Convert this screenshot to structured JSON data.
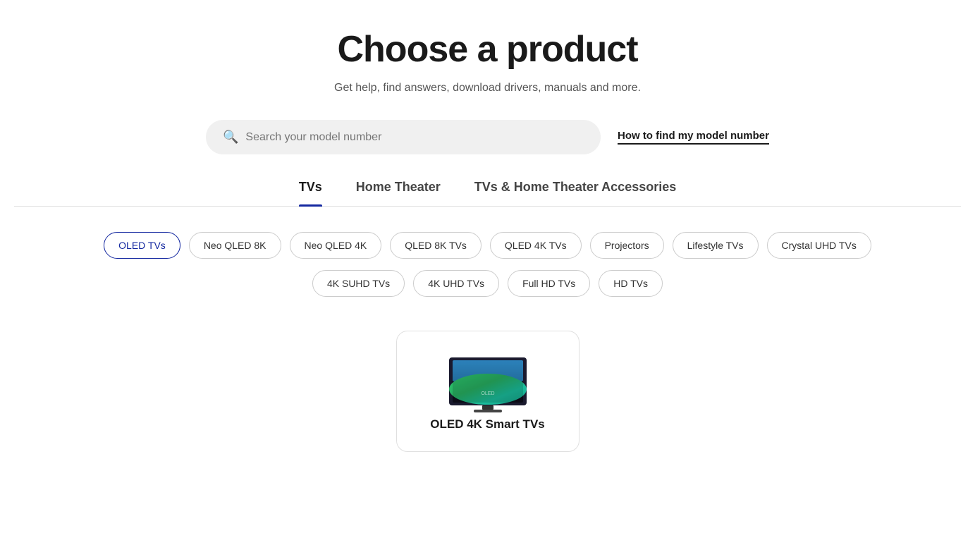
{
  "page": {
    "title": "Choose a product",
    "subtitle": "Get help, find answers, download drivers, manuals and more."
  },
  "search": {
    "placeholder": "Search your model number",
    "model_link": "How to find my model number"
  },
  "tabs": [
    {
      "id": "tvs",
      "label": "TVs",
      "active": true
    },
    {
      "id": "home-theater",
      "label": "Home Theater",
      "active": false
    },
    {
      "id": "tvs-accessories",
      "label": "TVs & Home Theater Accessories",
      "active": false
    }
  ],
  "pills_row1": [
    {
      "label": "OLED TVs",
      "active": true
    },
    {
      "label": "Neo QLED 8K",
      "active": false
    },
    {
      "label": "Neo QLED 4K",
      "active": false
    },
    {
      "label": "QLED 8K TVs",
      "active": false
    },
    {
      "label": "QLED 4K TVs",
      "active": false
    },
    {
      "label": "Projectors",
      "active": false
    },
    {
      "label": "Lifestyle TVs",
      "active": false
    },
    {
      "label": "Crystal UHD TVs",
      "active": false
    }
  ],
  "pills_row2": [
    {
      "label": "4K SUHD TVs",
      "active": false
    },
    {
      "label": "4K UHD TVs",
      "active": false
    },
    {
      "label": "Full HD TVs",
      "active": false
    },
    {
      "label": "HD TVs",
      "active": false
    }
  ],
  "product_card": {
    "name": "OLED 4K Smart TVs"
  },
  "colors": {
    "active_tab": "#1428a0",
    "active_pill_border": "#1428a0",
    "active_pill_text": "#1428a0"
  }
}
